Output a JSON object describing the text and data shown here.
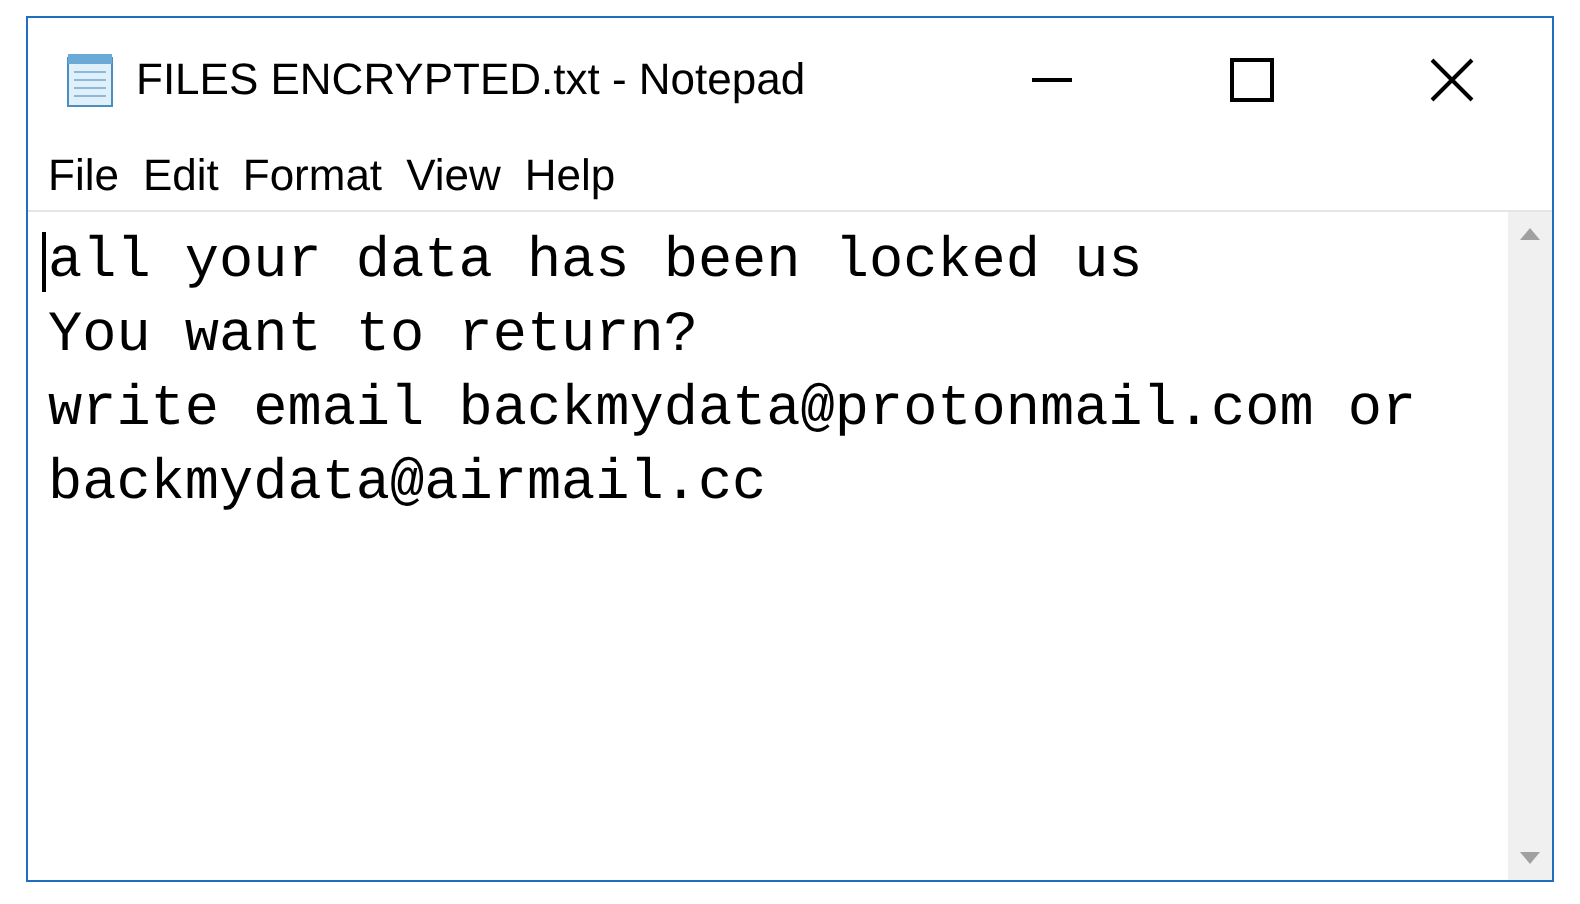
{
  "window": {
    "title": "FILES ENCRYPTED.txt - Notepad"
  },
  "menu": [
    {
      "label": "File"
    },
    {
      "label": "Edit"
    },
    {
      "label": "Format"
    },
    {
      "label": "View"
    },
    {
      "label": "Help"
    }
  ],
  "editor": {
    "lines": [
      "all your data has been locked us",
      "You want to return?",
      "write email backmydata@protonmail.com or",
      "backmydata@airmail.cc"
    ]
  }
}
